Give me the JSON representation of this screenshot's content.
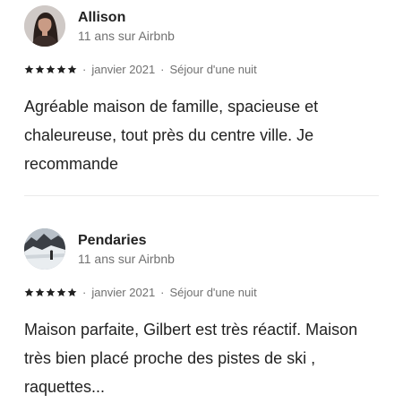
{
  "reviews": [
    {
      "author": "Allison",
      "member_since": "11 ans sur Airbnb",
      "rating": 5,
      "date": "janvier 2021",
      "stay": "Séjour d'une nuit",
      "comment": "Agréable maison de famille, spacieuse et chaleureuse, tout près du centre ville. Je recommande",
      "avatar_icon": "user-portrait"
    },
    {
      "author": "Pendaries",
      "member_since": "11 ans sur Airbnb",
      "rating": 5,
      "date": "janvier 2021",
      "stay": "Séjour d'une nuit",
      "comment": "Maison parfaite, Gilbert est très réactif. Maison très bien placé proche des pistes de ski , raquettes...",
      "avatar_icon": "snowy-mountain-photo"
    }
  ],
  "separator": "·",
  "colors": {
    "text": "#222222",
    "muted": "#717171",
    "divider": "#ebebeb"
  }
}
